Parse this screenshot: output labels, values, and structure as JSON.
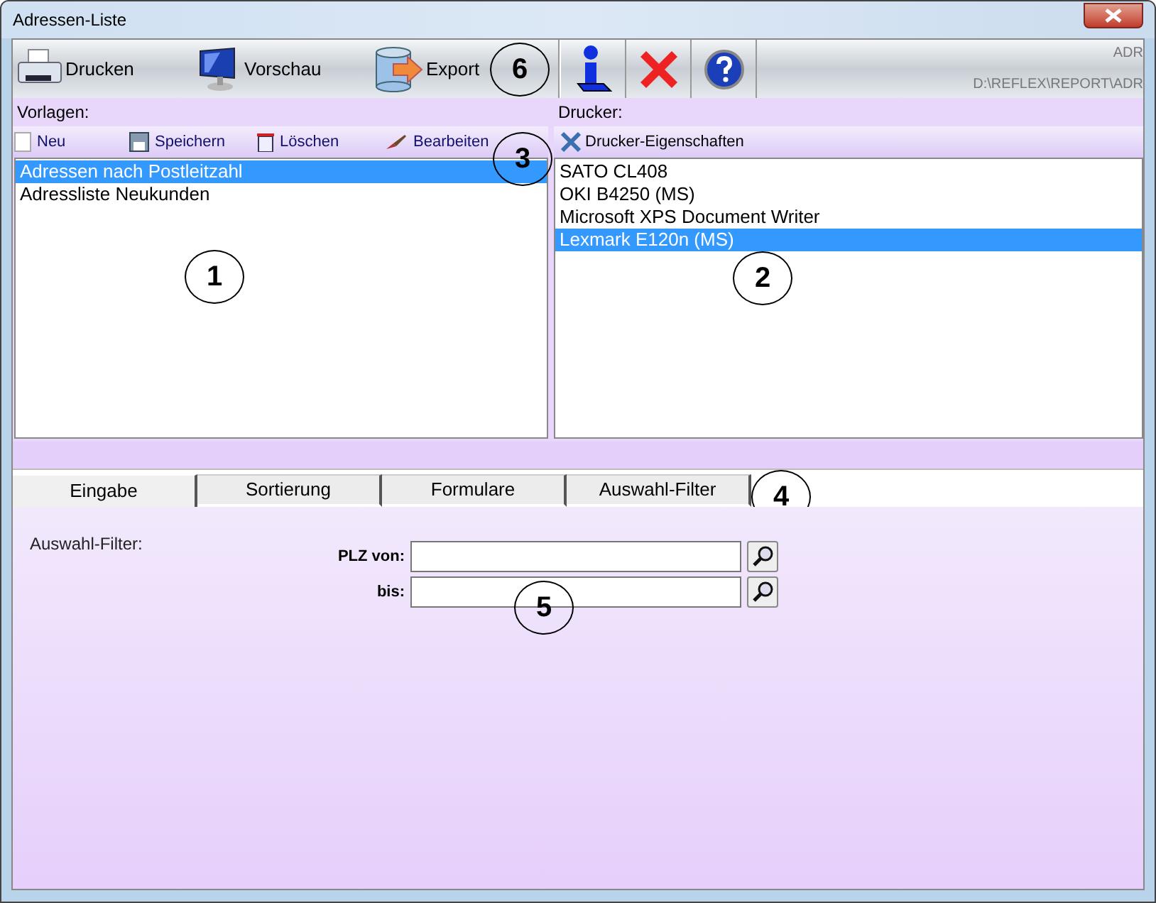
{
  "window": {
    "title": "Adressen-Liste"
  },
  "toolbar": {
    "buttons": [
      {
        "label": "Drucken",
        "kind": "printer"
      },
      {
        "label": "Vorschau",
        "kind": "monitor"
      },
      {
        "label": "Export",
        "kind": "database"
      }
    ],
    "icons": [
      {
        "kind": "info"
      },
      {
        "kind": "cancel"
      },
      {
        "kind": "help"
      }
    ],
    "code": "ADR",
    "path": "D:\\REFLEX\\REPORT\\ADR",
    "callout": "6"
  },
  "templates": {
    "label": "Vorlagen:",
    "actions": [
      {
        "label": "Neu",
        "kind": "new"
      },
      {
        "label": "Speichern",
        "kind": "save"
      },
      {
        "label": "Löschen",
        "kind": "delete"
      },
      {
        "label": "Bearbeiten",
        "kind": "edit"
      }
    ],
    "callout_actions": "3",
    "items": [
      {
        "label": "Adressen nach Postleitzahl",
        "selected": true
      },
      {
        "label": "Adressliste Neukunden",
        "selected": false
      }
    ],
    "callout": "1"
  },
  "printers": {
    "label": "Drucker:",
    "action": "Drucker-Eigenschaften",
    "items": [
      {
        "label": "SATO CL408",
        "selected": false
      },
      {
        "label": "OKI B4250 (MS)",
        "selected": false
      },
      {
        "label": "Microsoft XPS Document Writer",
        "selected": false
      },
      {
        "label": "Lexmark E120n (MS)",
        "selected": true
      }
    ],
    "callout": "2"
  },
  "tabs": [
    {
      "label": "Eingabe",
      "selected": true
    },
    {
      "label": "Sortierung",
      "selected": false
    },
    {
      "label": "Formulare",
      "selected": false
    },
    {
      "label": "Auswahl-Filter",
      "selected": false
    }
  ],
  "tabs_callout": "4",
  "filter": {
    "heading": "Auswahl-Filter:",
    "fields": [
      {
        "label": "PLZ von:"
      },
      {
        "label": "bis:"
      }
    ],
    "callout": "5"
  }
}
